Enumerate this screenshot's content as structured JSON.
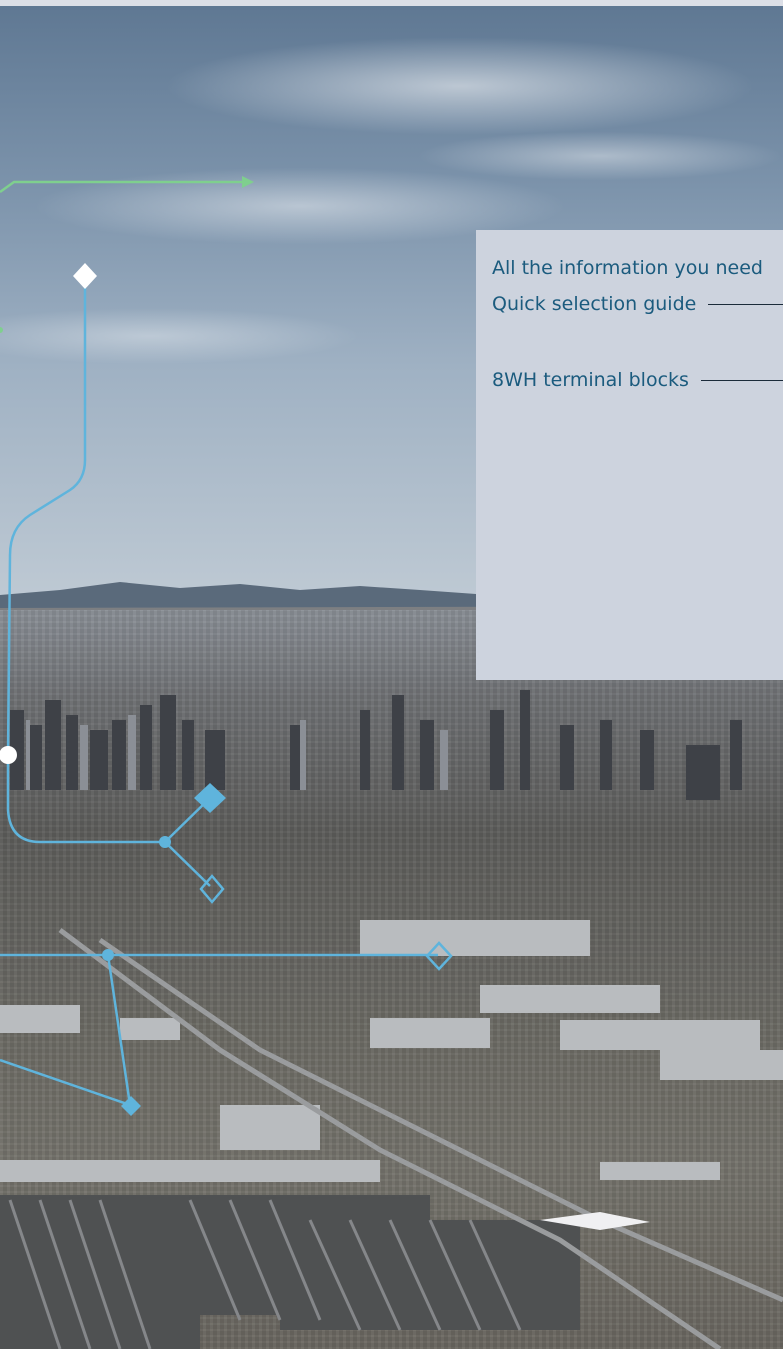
{
  "panel": {
    "intro_text": "All the information you need",
    "links": [
      {
        "label": "Quick selection guide"
      },
      {
        "label": "8WH terminal blocks"
      }
    ]
  },
  "colors": {
    "panel_bg": "#cdd3de",
    "link_text": "#1b5b7e",
    "line_blue": "#5fb4dc",
    "line_green": "#7fcf8e"
  },
  "icons": [
    "diamond-marker-icon",
    "arrow-head-icon",
    "node-dot-icon"
  ]
}
